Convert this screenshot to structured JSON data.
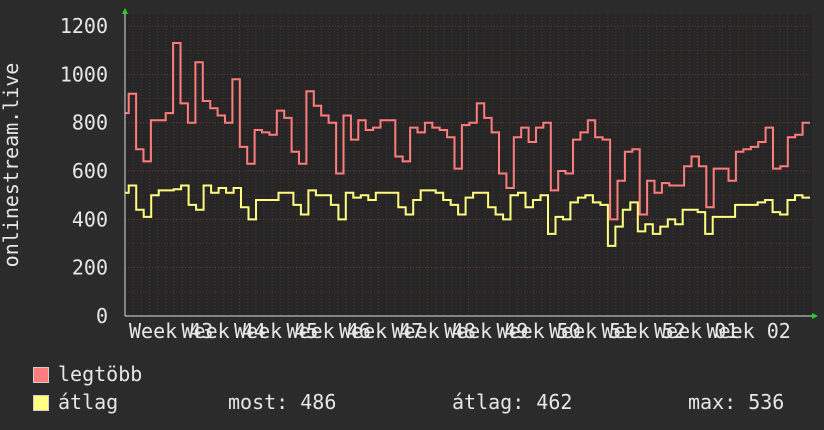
{
  "chart_data": {
    "type": "line",
    "ylabel": "onlinestream.live",
    "ylim": [
      0,
      1250
    ],
    "yticks": [
      0,
      200,
      400,
      600,
      800,
      1000,
      1200
    ],
    "xticks": [
      "Week 43",
      "Week 44",
      "Week 45",
      "Week 46",
      "Week 47",
      "Week 48",
      "Week 49",
      "Week 50",
      "Week 51",
      "Week 52",
      "Week 01",
      "Week 02"
    ],
    "grid": true,
    "series": [
      {
        "name": "legtöbb",
        "color": "#ff7d7d",
        "values": [
          840,
          920,
          920,
          690,
          690,
          640,
          640,
          810,
          810,
          810,
          810,
          840,
          840,
          1130,
          1130,
          880,
          880,
          800,
          800,
          1050,
          1050,
          890,
          890,
          860,
          860,
          830,
          830,
          800,
          800,
          980,
          980,
          700,
          700,
          630,
          630,
          770,
          770,
          760,
          760,
          750,
          750,
          850,
          850,
          820,
          820,
          680,
          680,
          630,
          630,
          930,
          930,
          870,
          870,
          830,
          830,
          800,
          800,
          590,
          590,
          830,
          830,
          730,
          730,
          810,
          810,
          770,
          770,
          780,
          780,
          810,
          810,
          810,
          810,
          660,
          660,
          640,
          640,
          780,
          780,
          760,
          760,
          800,
          800,
          780,
          780,
          770,
          770,
          740,
          740,
          610,
          610,
          790,
          790,
          800,
          800,
          880,
          880,
          820,
          820,
          760,
          760,
          590,
          590,
          530,
          530,
          740,
          740,
          780,
          780,
          720,
          720,
          780,
          780,
          800,
          800,
          520,
          520,
          600,
          600,
          590,
          590,
          730,
          730,
          760,
          760,
          810,
          810,
          740,
          740,
          730,
          730,
          400,
          400,
          560,
          560,
          680,
          680,
          690,
          690,
          420,
          420,
          560,
          560,
          510,
          510,
          550,
          550,
          540,
          540,
          540,
          540,
          620,
          620,
          660,
          660,
          620,
          620,
          450,
          450,
          610,
          610,
          610,
          610,
          560,
          560,
          680,
          680,
          690,
          690,
          700,
          700,
          720,
          720,
          780,
          780,
          610,
          610,
          620,
          620,
          740,
          740,
          750,
          750,
          800,
          800
        ]
      },
      {
        "name": "átlag",
        "color": "#ffff80",
        "values": [
          510,
          540,
          540,
          440,
          440,
          410,
          410,
          500,
          500,
          520,
          520,
          520,
          520,
          525,
          525,
          540,
          540,
          460,
          460,
          440,
          440,
          540,
          540,
          510,
          510,
          530,
          530,
          510,
          510,
          530,
          530,
          450,
          450,
          400,
          400,
          480,
          480,
          480,
          480,
          480,
          480,
          510,
          510,
          510,
          510,
          460,
          460,
          420,
          420,
          520,
          520,
          500,
          500,
          500,
          500,
          460,
          460,
          400,
          400,
          510,
          510,
          490,
          490,
          500,
          500,
          480,
          480,
          510,
          510,
          510,
          510,
          510,
          510,
          450,
          450,
          420,
          420,
          480,
          480,
          520,
          520,
          520,
          520,
          510,
          510,
          480,
          480,
          460,
          460,
          420,
          420,
          490,
          490,
          510,
          510,
          510,
          510,
          450,
          450,
          420,
          420,
          400,
          400,
          500,
          500,
          510,
          510,
          450,
          450,
          480,
          480,
          500,
          500,
          340,
          340,
          410,
          410,
          400,
          400,
          470,
          470,
          490,
          490,
          500,
          500,
          470,
          470,
          460,
          460,
          290,
          290,
          370,
          370,
          440,
          440,
          470,
          470,
          350,
          350,
          380,
          380,
          340,
          340,
          370,
          370,
          400,
          400,
          380,
          380,
          440,
          440,
          440,
          440,
          430,
          430,
          340,
          340,
          410,
          410,
          410,
          410,
          410,
          410,
          460,
          460,
          460,
          460,
          460,
          460,
          470,
          470,
          480,
          480,
          430,
          430,
          420,
          420,
          480,
          480,
          500,
          500,
          490,
          490
        ]
      }
    ],
    "legend_stats": {
      "most": "most: 486",
      "atlag": "átlag: 462",
      "max": "max: 536"
    }
  }
}
